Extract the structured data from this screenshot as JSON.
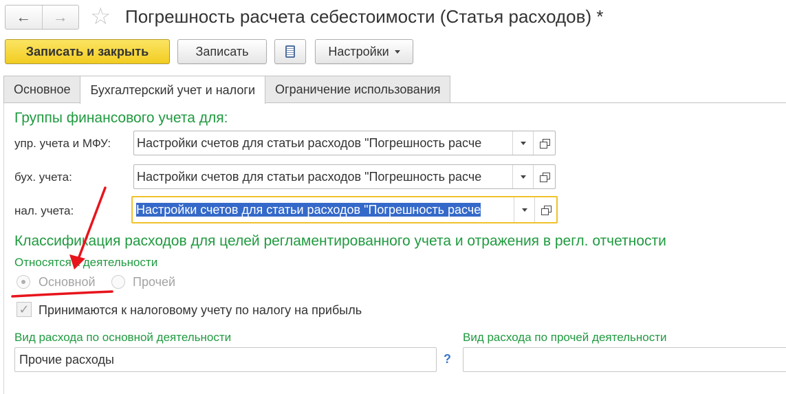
{
  "window": {
    "title": "Погрешность расчета себестоимости (Статья расходов) *",
    "back_icon": "←",
    "forward_icon": "→",
    "favorite_icon": "☆"
  },
  "toolbar": {
    "save_close_label": "Записать и закрыть",
    "save_label": "Записать",
    "settings_label": "Настройки"
  },
  "tabs": [
    {
      "label": "Основное"
    },
    {
      "label": "Бухгалтерский учет и налоги"
    },
    {
      "label": "Ограничение использования"
    }
  ],
  "fin_groups": {
    "title": "Группы финансового учета для:",
    "rows": [
      {
        "label": "упр. учета и МФУ:",
        "value": "Настройки счетов для статьи расходов \"Погрешность расче"
      },
      {
        "label": "бух. учета:",
        "value": "Настройки счетов для статьи расходов \"Погрешность расче"
      },
      {
        "label": "нал. учета:",
        "value": "Настройки счетов для статьи расходов \"Погрешность расче"
      }
    ]
  },
  "classification": {
    "title": "Классификация расходов для целей регламентированного учета и отражения в регл. отчетности",
    "activity_label": "Относятся к деятельности",
    "option_main": "Основной",
    "option_other": "Прочей",
    "selected": "Основной",
    "tax_checkbox_label": "Принимаются к налоговому учету по налогу на прибыль",
    "tax_checkbox_checked": true,
    "main_type_label": "Вид расхода по основной деятельности",
    "main_type_value": "Прочие расходы",
    "help_mark": "?",
    "other_type_label": "Вид расхода по прочей деятельности",
    "other_type_value": ""
  },
  "colors": {
    "accent_green": "#1f9a3f",
    "primary_button": "#f2cd21",
    "focus_border": "#f0c12b",
    "selection": "#3569c9",
    "annotation_red": "#e8141c"
  }
}
